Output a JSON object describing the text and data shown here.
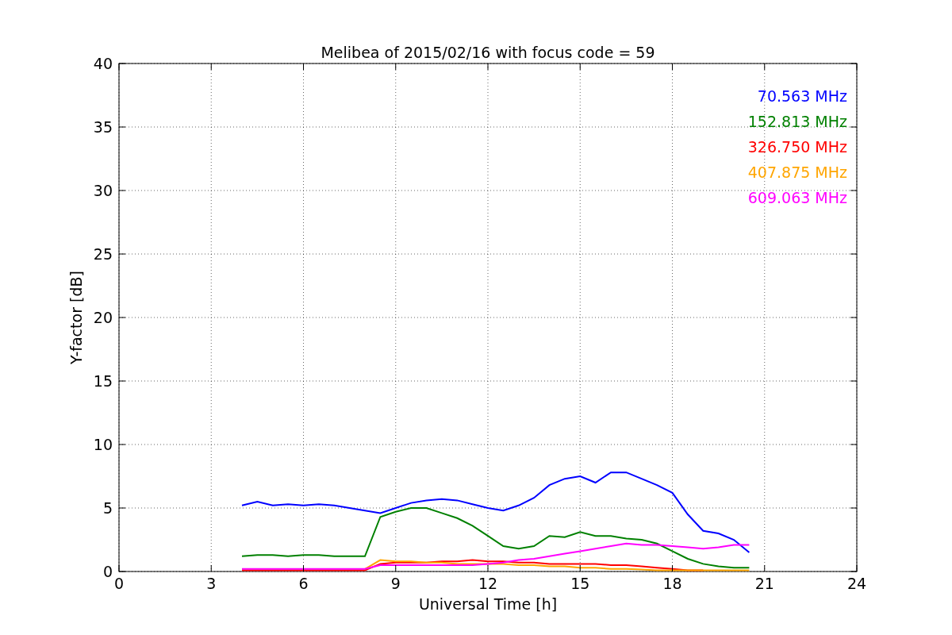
{
  "chart_data": {
    "type": "line",
    "title": "Melibea of 2015/02/16 with focus code = 59",
    "xlabel": "Universal Time [h]",
    "ylabel": "Y-factor [dB]",
    "grid": true,
    "xlim": [
      0,
      24
    ],
    "ylim": [
      0,
      40
    ],
    "xticks": [
      0,
      3,
      6,
      9,
      12,
      15,
      18,
      21,
      24
    ],
    "yticks": [
      0,
      5,
      10,
      15,
      20,
      25,
      30,
      35,
      40
    ],
    "x": [
      4,
      4.5,
      5,
      5.5,
      6,
      6.5,
      7,
      7.5,
      8,
      8.5,
      9,
      9.5,
      10,
      10.5,
      11,
      11.5,
      12,
      12.5,
      13,
      13.5,
      14,
      14.5,
      15,
      15.5,
      16,
      16.5,
      17,
      17.5,
      18,
      18.5,
      19,
      19.5,
      20,
      20.5
    ],
    "series": [
      {
        "name": "70.563 MHz",
        "color": "#0000ff",
        "values": [
          5.2,
          5.5,
          5.2,
          5.3,
          5.2,
          5.3,
          5.2,
          5.0,
          4.8,
          4.6,
          5.0,
          5.4,
          5.6,
          5.7,
          5.6,
          5.3,
          5.0,
          4.8,
          5.2,
          5.8,
          6.8,
          7.3,
          7.5,
          7.0,
          7.8,
          7.8,
          7.3,
          6.8,
          6.2,
          4.5,
          3.2,
          3.0,
          2.5,
          1.5
        ]
      },
      {
        "name": "152.813 MHz",
        "color": "#008000",
        "values": [
          1.2,
          1.3,
          1.3,
          1.2,
          1.3,
          1.3,
          1.2,
          1.2,
          1.2,
          4.3,
          4.7,
          5.0,
          5.0,
          4.6,
          4.2,
          3.6,
          2.8,
          2.0,
          1.8,
          2.0,
          2.8,
          2.7,
          3.1,
          2.8,
          2.8,
          2.6,
          2.5,
          2.2,
          1.6,
          1.0,
          0.6,
          0.4,
          0.3,
          0.3
        ]
      },
      {
        "name": "326.750 MHz",
        "color": "#ff0000",
        "values": [
          0.1,
          0.1,
          0.1,
          0.1,
          0.1,
          0.1,
          0.1,
          0.1,
          0.1,
          0.6,
          0.7,
          0.7,
          0.7,
          0.8,
          0.8,
          0.9,
          0.8,
          0.8,
          0.7,
          0.7,
          0.6,
          0.6,
          0.6,
          0.6,
          0.5,
          0.5,
          0.4,
          0.3,
          0.2,
          0.1,
          0.1,
          null,
          null,
          null
        ]
      },
      {
        "name": "407.875 MHz",
        "color": "#ffa500",
        "values": [
          null,
          null,
          null,
          null,
          null,
          null,
          null,
          null,
          0.2,
          0.9,
          0.8,
          0.8,
          0.7,
          0.7,
          0.6,
          0.6,
          0.6,
          0.6,
          0.5,
          0.5,
          0.4,
          0.4,
          0.3,
          0.3,
          0.2,
          0.2,
          0.15,
          0.1,
          0.1,
          0.1,
          0.1,
          0.1,
          0.1,
          0.1
        ]
      },
      {
        "name": "609.063 MHz",
        "color": "#ff00ff",
        "values": [
          0.2,
          0.2,
          0.2,
          0.2,
          0.2,
          0.2,
          0.2,
          0.2,
          0.2,
          0.5,
          0.5,
          0.5,
          0.5,
          0.5,
          0.5,
          0.5,
          0.6,
          0.7,
          0.9,
          1.0,
          1.2,
          1.4,
          1.6,
          1.8,
          2.0,
          2.2,
          2.1,
          2.1,
          2.0,
          1.9,
          1.8,
          1.9,
          2.1,
          2.1
        ]
      }
    ]
  }
}
